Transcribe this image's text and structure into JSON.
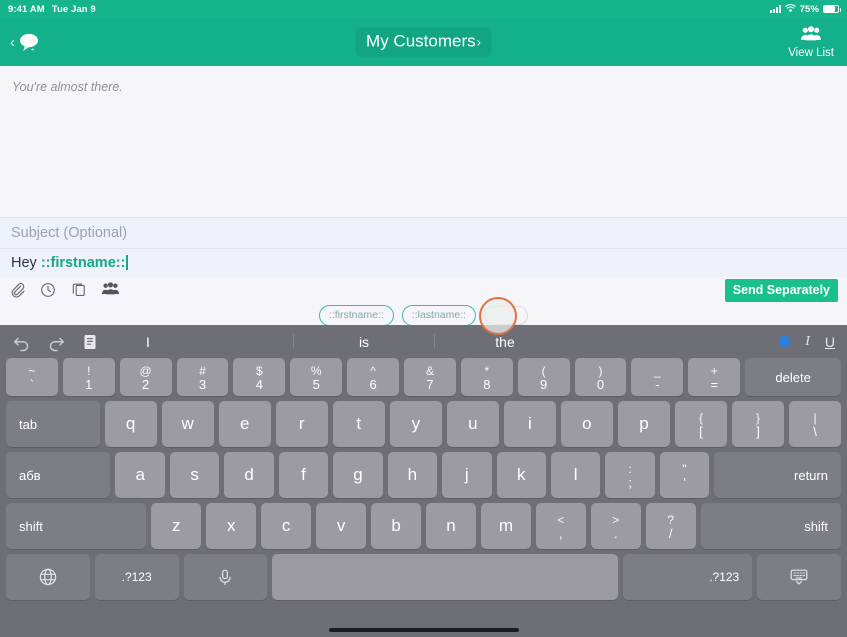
{
  "status_bar": {
    "time": "9:41 AM",
    "date": "Tue Jan 9",
    "battery_percent": "75%",
    "signal_icon": "cellular-bars-icon",
    "wifi_icon": "wifi-icon",
    "battery_icon": "battery-icon"
  },
  "nav": {
    "back_icon": "chevron-left-icon",
    "messages_icon": "speech-bubble-icon",
    "title": "My Customers",
    "title_chevron": "›",
    "right_icon": "group-people-icon",
    "right_label": "View List",
    "bg_color": "#13b089"
  },
  "compose": {
    "body_hint": "You're almost there.",
    "subject_placeholder": "Subject (Optional)",
    "message_prefix": "Hey ",
    "message_tag": "::firstname::",
    "tag_color": "#12a887"
  },
  "toolbar": {
    "icons": [
      {
        "name": "paperclip-icon"
      },
      {
        "name": "clock-icon"
      },
      {
        "name": "copy-template-icon"
      },
      {
        "name": "group-people-icon"
      }
    ],
    "send_label": "Send Separately",
    "send_color": "#19c08c"
  },
  "suggestions": {
    "chips": [
      "::firstname::",
      "::lastname::"
    ],
    "touch_indicator": "touch-point-indicator",
    "touch_ring_color": "#e2713f"
  },
  "keyboard": {
    "top_icons": [
      {
        "name": "undo-icon"
      },
      {
        "name": "redo-icon"
      },
      {
        "name": "paste-icon"
      }
    ],
    "predictions": [
      "I",
      "is",
      "the"
    ],
    "format": {
      "bold_indicator": "bold-active-dot",
      "italic_label": "I",
      "underline_label": "U",
      "active_color": "#2b7fe3"
    },
    "row_numbers": [
      {
        "up": "~",
        "lo": "`"
      },
      {
        "up": "!",
        "lo": "1"
      },
      {
        "up": "@",
        "lo": "2"
      },
      {
        "up": "#",
        "lo": "3"
      },
      {
        "up": "$",
        "lo": "4"
      },
      {
        "up": "%",
        "lo": "5"
      },
      {
        "up": "^",
        "lo": "6"
      },
      {
        "up": "&",
        "lo": "7"
      },
      {
        "up": "*",
        "lo": "8"
      },
      {
        "up": "(",
        "lo": "9"
      },
      {
        "up": ")",
        "lo": "0"
      },
      {
        "up": "_",
        "lo": "-"
      },
      {
        "up": "+",
        "lo": "="
      }
    ],
    "delete_label": "delete",
    "tab_label": "tab",
    "row_qwerty": [
      "q",
      "w",
      "e",
      "r",
      "t",
      "y",
      "u",
      "i",
      "o",
      "p"
    ],
    "row_qwerty_extra": [
      {
        "up": "{",
        "lo": "["
      },
      {
        "up": "}",
        "lo": "]"
      },
      {
        "up": "|",
        "lo": "\\"
      }
    ],
    "lang_label": "абв",
    "row_home": [
      "a",
      "s",
      "d",
      "f",
      "g",
      "h",
      "j",
      "k",
      "l"
    ],
    "row_home_extra": [
      {
        "up": ":",
        "lo": ";"
      },
      {
        "up": "\"",
        "lo": "'"
      }
    ],
    "return_label": "return",
    "shift_label": "shift",
    "row_bottom": [
      "z",
      "x",
      "c",
      "v",
      "b",
      "n",
      "m"
    ],
    "row_bottom_extra": [
      {
        "up": "<",
        "lo": ","
      },
      {
        "up": ">",
        "lo": "."
      },
      {
        "up": "?",
        "lo": "/"
      }
    ],
    "globe_icon": "globe-icon",
    "numeric_label": ".?123",
    "mic_icon": "microphone-icon",
    "space_label": "",
    "numeric_label_right": ".?123",
    "dismiss_icon": "hide-keyboard-icon"
  }
}
